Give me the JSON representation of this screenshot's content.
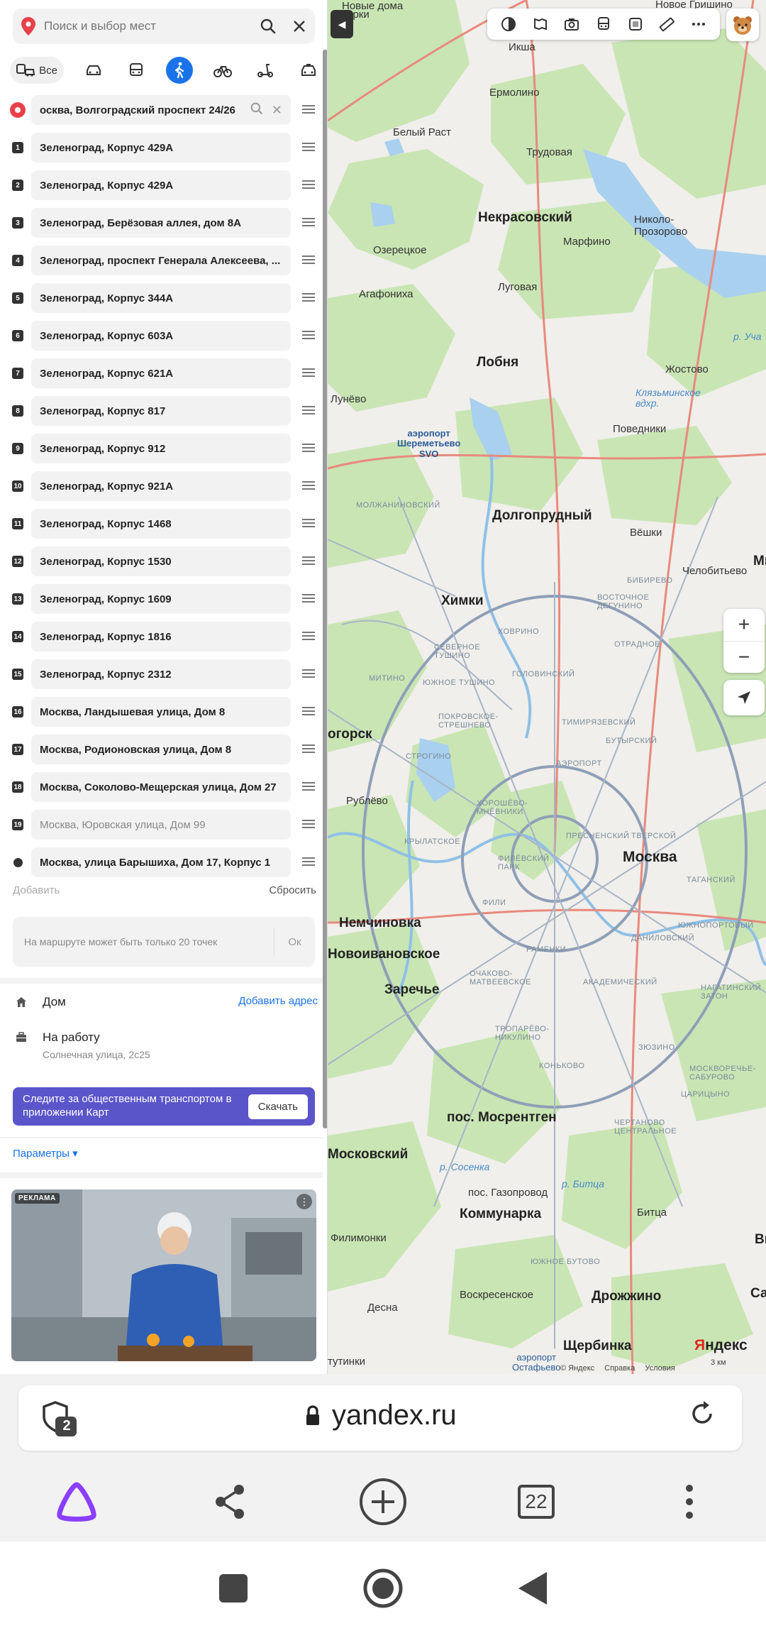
{
  "search": {
    "placeholder": "Поиск и выбор мест"
  },
  "modes": {
    "all_label": "Все"
  },
  "route": {
    "start": "осква, Волгоградский проспект 24/26",
    "points": [
      {
        "num": "1",
        "text": "Зеленоград, Корпус 429А"
      },
      {
        "num": "2",
        "text": "Зеленоград, Корпус 429А"
      },
      {
        "num": "3",
        "text": "Зеленоград, Берёзовая аллея, дом 8А"
      },
      {
        "num": "4",
        "text": "Зеленоград, проспект Генерала Алексеева, ..."
      },
      {
        "num": "5",
        "text": "Зеленоград, Корпус 344А"
      },
      {
        "num": "6",
        "text": "Зеленоград, Корпус 603А"
      },
      {
        "num": "7",
        "text": "Зеленоград, Корпус 621А"
      },
      {
        "num": "8",
        "text": "Зеленоград, Корпус 817"
      },
      {
        "num": "9",
        "text": "Зеленоград, Корпус 912"
      },
      {
        "num": "10",
        "text": "Зеленоград, Корпус 921А"
      },
      {
        "num": "11",
        "text": "Зеленоград, Корпус 1468"
      },
      {
        "num": "12",
        "text": "Зеленоград, Корпус 1530"
      },
      {
        "num": "13",
        "text": "Зеленоград, Корпус 1609"
      },
      {
        "num": "14",
        "text": "Зеленоград, Корпус 1816"
      },
      {
        "num": "15",
        "text": "Зеленоград, Корпус 2312"
      },
      {
        "num": "16",
        "text": "Москва, Ландышевая улица, Дом 8"
      },
      {
        "num": "17",
        "text": "Москва, Родионовская улица, Дом 8"
      },
      {
        "num": "18",
        "text": "Москва, Соколово-Мещерская улица, Дом 27"
      },
      {
        "num": "19",
        "text": "Москва, Юровская улица, Дом 99"
      }
    ],
    "end": "Москва, улица Барышиха, Дом 17, Корпус 1",
    "add_label": "Добавить",
    "reset_label": "Сбросить",
    "limit_msg": "На маршруте может быть только 20 точек",
    "ok_label": "Ок"
  },
  "places": {
    "home_label": "Дом",
    "home_link": "Добавить адрес",
    "work_label": "На работу",
    "work_address": "Солнечная улица, 2с25"
  },
  "promo": {
    "text": "Следите за общественным транспортом в приложении Карт",
    "button": "Скачать"
  },
  "params_label": "Параметры ▾",
  "ad": {
    "badge": "РЕКЛАМА"
  },
  "map": {
    "labels": {
      "novye_dolgoprudny": "Новые дома",
      "gorki": "Горки",
      "novoe_grishino": "Новое Гришино",
      "iksha": "Икша",
      "ermolino": "Ермолино",
      "belyy_rast": "Белый Раст",
      "trudovaya": "Трудовая",
      "nekrasovsky": "Некрасовский",
      "nikolo": "Николо-\nПрозорово",
      "ozeretskoe": "Озерецкое",
      "marfino": "Марфино",
      "lugovaya": "Луговая",
      "agafonikha": "Агафониха",
      "lobnya": "Лобня",
      "zhostovo": "Жостово",
      "klyazma": "Клязьминское\nвдхр.",
      "lunevo": "Лунёво",
      "povedniki": "Поведники",
      "airport": "аэропорт\nШереметьево\nSVO",
      "dolgoprudny": "Долгопрудный",
      "veshki": "Вёшки",
      "chelobitevo": "Челобитьево",
      "mi": "Ми",
      "khimki": "Химки",
      "ogorsk": "огорск",
      "rublevo": "Рублёво",
      "moskva": "Москва",
      "nemchinovka": "Немчиновка",
      "novoivanovskoe": "Новоивановское",
      "zarechye": "Заречье",
      "mosrentgen": "пос. Мосрентген",
      "moskovsky": "Московский",
      "gazoprovod": "пос. Газопровод",
      "kommunarka": "Коммунарка",
      "vidnoe": "Видно",
      "filimonki": "Филимонки",
      "bitsa": "Битца",
      "sapron": "Сапрон",
      "drozhzhino": "Дрожжино",
      "desna": "Десна",
      "voskresenskoe": "Воскресенское",
      "shcherbinka": "Щербинка",
      "airport2": "аэропорт\nОстафьево",
      "tutinki": "тутинки",
      "d1": "ВОСТОЧНОЕ\nДЕГУНИНО",
      "d2": "ОТРАДНОЕ",
      "d3": "СЕВЕРНОЕ\nТУШИНО",
      "d4": "ЮЖНОЕ ТУШИНО",
      "d5": "ГОЛОВИНСКИЙ",
      "d6": "ТИМИРЯЗЕВСКИЙ",
      "d7": "ПОКРОВСКОЕ-\nСТРЕШНЕВО",
      "d8": "СТРОГИНО",
      "d9": "ХОРОШЁВО-\nМНЁВНИКИ",
      "d10": "КРЫЛАТСКОЕ",
      "d11": "ФИЛЁВСКИЙ\nПАРК",
      "d12": "ПРЕСНЕНСКИЙ",
      "d13": "ТВЕРСКОЙ",
      "d14": "ТАГАНСКИЙ",
      "d15": "ЮЖНОПОРТОВЫЙ",
      "d16": "ДАНИЛОВСКИЙ",
      "d17": "РАМЕНКИ",
      "d18": "ОЧАКОВО-\nМАТВЕЕВСКОЕ",
      "d19": "АКАДЕМИЧЕСКИЙ",
      "d20": "ТРОПАРЁВО-\nНИКУЛИНО",
      "d21": "КОНЬКОВО",
      "d22": "ЗЮЗИНО",
      "d23": "НАГАТИНСКИЙ\nЗАТОН",
      "d24": "МОСКВОРЕЧЬЕ-\nСАБУРОВО",
      "d25": "ЦАРИЦЫНО",
      "d26": "ЧЕРТАНОВО\nЦЕНТРАЛЬНОЕ",
      "d27": "ЮЖНОЕ БУТОВО",
      "d28": "АЭРОПОРТ",
      "d29": "БУТЫРСКИЙ",
      "d30": "МИТИНО",
      "d31": "МОЛЖАНИНОВСКИЙ",
      "d32": "ХОВРИНО",
      "d33": "БИБИРЕВО",
      "d34": "ФИЛИ",
      "water1": "р. Уча",
      "water2": "р. Сосенка",
      "water3": "р. Битца"
    },
    "logo_y": "Я",
    "logo_rest": "ндекс",
    "copyright": "© Яндекс",
    "help": "Справка",
    "terms": "Условия",
    "scale": "3 км"
  },
  "browser": {
    "url": "yandex.ru",
    "shield_count": "2",
    "tabs_count": "22"
  },
  "colors": {
    "accent": "#1a73e8",
    "promo": "#5a55c9",
    "start_pin": "#e8414a",
    "alice": "#8a3ffc"
  }
}
